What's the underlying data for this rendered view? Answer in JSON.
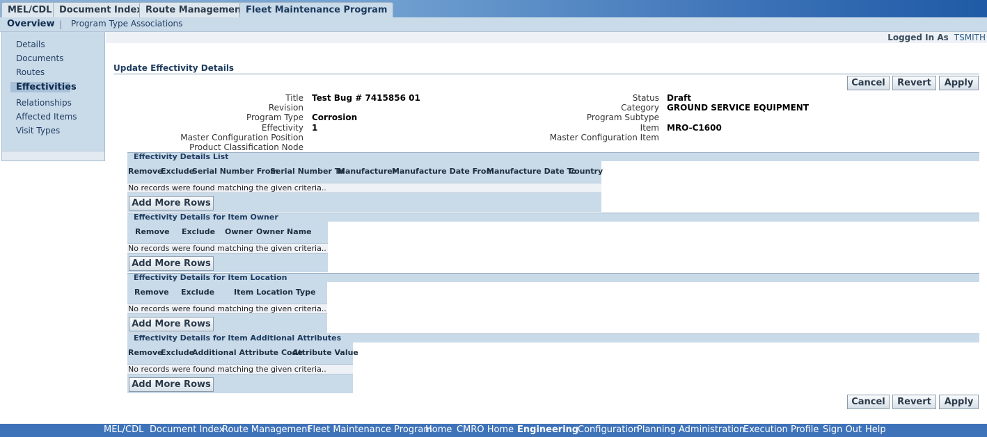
{
  "tabs": [
    "MEL/CDL",
    "Document Index",
    "Route Management",
    "Fleet Maintenance Program"
  ],
  "subtabs": [
    "Overview",
    "Program Type Associations"
  ],
  "sidenav": [
    "Details",
    "Documents",
    "Routes",
    "Effectivities",
    "Relationships",
    "Affected Items",
    "Visit Types"
  ],
  "login": {
    "label": "Logged In As",
    "user": "TSMITH"
  },
  "page_title": "Update Effectivity Details",
  "buttons": {
    "cancel": "Cancel",
    "revert": "Revert",
    "apply": "Apply"
  },
  "fields_left": [
    {
      "label": "Title",
      "value": "Test Bug # 7415856 01"
    },
    {
      "label": "Revision",
      "value": ""
    },
    {
      "label": "Program Type",
      "value": "Corrosion"
    },
    {
      "label": "Effectivity",
      "value": "1"
    },
    {
      "label": "Master Configuration Position",
      "value": ""
    },
    {
      "label": "Product Classification Node",
      "value": ""
    }
  ],
  "fields_right": [
    {
      "label": "Status",
      "value": "Draft"
    },
    {
      "label": "Category",
      "value": "GROUND SERVICE EQUIPMENT"
    },
    {
      "label": "Program Subtype",
      "value": ""
    },
    {
      "label": "Item",
      "value": "MRO-C1600"
    },
    {
      "label": "Master Configuration Item",
      "value": ""
    }
  ],
  "sections": [
    {
      "title": "Effectivity Details List",
      "columns": [
        "Remove",
        "Exclude",
        "Serial Number From",
        "Serial Number To",
        "Manufacturer",
        "Manufacture Date From",
        "Manufacture Date To",
        "Country"
      ]
    },
    {
      "title": "Effectivity Details for Item Owner",
      "columns": [
        "Remove",
        "Exclude",
        "Owner",
        "Owner Name"
      ]
    },
    {
      "title": "Effectivity Details for Item Location",
      "columns": [
        "Remove",
        "Exclude",
        "Item Location Type"
      ]
    },
    {
      "title": "Effectivity Details for Item Additional Attributes",
      "columns": [
        "Remove",
        "Exclude",
        "Additional Attribute Code",
        "Attribute Value"
      ]
    }
  ],
  "no_records_text": "No records were found matching the given criteria..",
  "add_rows_label": "Add More Rows",
  "footer_links": [
    "MEL/CDL",
    "Document Index",
    "Route Management",
    "Fleet Maintenance Program",
    "Home",
    "CMRO Home",
    "Engineering",
    "Configuration",
    "Planning",
    "Administration",
    "Execution",
    "Profile",
    "Sign Out",
    "Help"
  ],
  "footer_active": "Engineering"
}
